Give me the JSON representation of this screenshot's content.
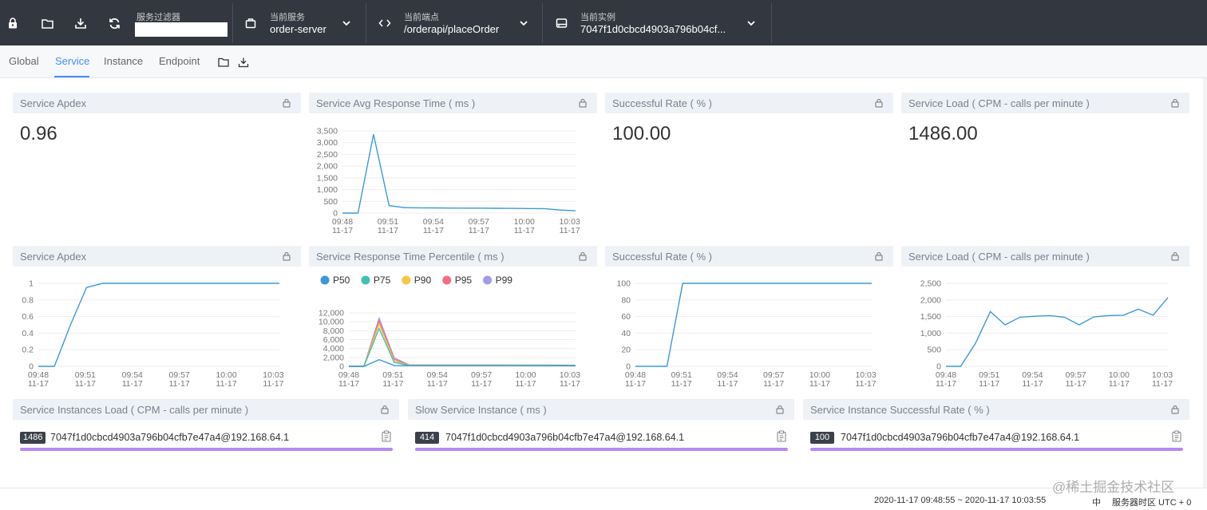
{
  "colors": {
    "topbar": "#333840",
    "accent": "#448dfe",
    "line": "#3a9ad9",
    "bar": "#b58af3"
  },
  "toolbar": {
    "icons": [
      "lock-icon",
      "folder-icon",
      "download-icon",
      "refresh-icon"
    ],
    "filter_label": "服务过滤器",
    "filter_value": "",
    "service_label": "当前服务",
    "service_value": "order-server",
    "endpoint_label": "当前端点",
    "endpoint_value": "/orderapi/placeOrder",
    "instance_label": "当前实例",
    "instance_value": "7047f1d0cbcd4903a796b04cf..."
  },
  "tabs": [
    "Global",
    "Service",
    "Instance",
    "Endpoint"
  ],
  "active_tab": "Service",
  "panels": {
    "apdex_value": {
      "title": "Service Apdex",
      "value": "0.96"
    },
    "avg_response": {
      "title": "Service Avg Response Time ( ms )"
    },
    "success_value": {
      "title": "Successful Rate ( % )",
      "value": "100.00"
    },
    "load_value": {
      "title": "Service Load ( CPM - calls per minute )",
      "value": "1486.00"
    },
    "apdex_chart": {
      "title": "Service Apdex"
    },
    "percentile": {
      "title": "Service Response Time Percentile ( ms )"
    },
    "success_chart": {
      "title": "Successful Rate ( % )"
    },
    "load_chart": {
      "title": "Service Load ( CPM - calls per minute )"
    },
    "instances_load": {
      "title": "Service Instances Load ( CPM - calls per minute )",
      "badge": "1486",
      "instance": "7047f1d0cbcd4903a796b04cfb7e47a4@192.168.64.1",
      "fill": 1.0
    },
    "slow_instance": {
      "title": "Slow Service Instance ( ms )",
      "badge": "414",
      "instance": "7047f1d0cbcd4903a796b04cfb7e47a4@192.168.64.1",
      "fill": 1.0
    },
    "instance_success": {
      "title": "Service Instance Successful Rate ( % )",
      "badge": "100",
      "instance": "7047f1d0cbcd4903a796b04cfb7e47a4@192.168.64.1",
      "fill": 1.0
    }
  },
  "chart_data": [
    {
      "id": "avg_response",
      "type": "line",
      "x_ticks": [
        "09:48\n11-17",
        "09:51\n11-17",
        "09:54\n11-17",
        "09:57\n11-17",
        "10:00\n11-17",
        "10:03\n11-17"
      ],
      "y_ticks": [
        "0",
        "500",
        "1,000",
        "1,500",
        "2,000",
        "2,500",
        "3,000",
        "3,500"
      ],
      "ylim": [
        0,
        3500
      ],
      "x": [
        0,
        1,
        2,
        3,
        4,
        5,
        6,
        7,
        8,
        9,
        10,
        11,
        12,
        13,
        14,
        15
      ],
      "series": [
        {
          "values": [
            0,
            0,
            3350,
            320,
            230,
            225,
            220,
            215,
            210,
            210,
            205,
            200,
            195,
            190,
            130,
            100
          ]
        }
      ]
    },
    {
      "id": "apdex_chart",
      "type": "line",
      "x_ticks": [
        "09:48\n11-17",
        "09:51\n11-17",
        "09:54\n11-17",
        "09:57\n11-17",
        "10:00\n11-17",
        "10:03\n11-17"
      ],
      "y_ticks": [
        "0",
        "0.2",
        "0.4",
        "0.6",
        "0.8",
        "1"
      ],
      "ylim": [
        0,
        1
      ],
      "x": [
        0,
        1,
        2,
        3,
        4,
        5,
        6,
        7,
        8,
        9,
        10,
        11,
        12,
        13,
        14,
        15
      ],
      "series": [
        {
          "values": [
            0,
            0,
            0.5,
            0.95,
            1,
            1,
            1,
            1,
            1,
            1,
            1,
            1,
            1,
            1,
            1,
            1
          ]
        }
      ]
    },
    {
      "id": "percentile",
      "type": "line",
      "x_ticks": [
        "09:48\n11-17",
        "09:51\n11-17",
        "09:54\n11-17",
        "09:57\n11-17",
        "10:00\n11-17",
        "10:03\n11-17"
      ],
      "y_ticks": [
        "0",
        "2,000",
        "4,000",
        "6,000",
        "8,000",
        "10,000",
        "12,000"
      ],
      "ylim": [
        0,
        12000
      ],
      "x": [
        0,
        1,
        2,
        3,
        4,
        5,
        6,
        7,
        8,
        9,
        10,
        11,
        12,
        13,
        14,
        15
      ],
      "series": [
        {
          "name": "P50",
          "color": "#3a9ad9",
          "values": [
            0,
            0,
            1500,
            200,
            150,
            150,
            150,
            140,
            140,
            140,
            140,
            140,
            130,
            130,
            120,
            110
          ]
        },
        {
          "name": "P75",
          "color": "#40c0b0",
          "values": [
            0,
            0,
            8500,
            900,
            200,
            200,
            200,
            200,
            200,
            200,
            200,
            200,
            200,
            200,
            180,
            170
          ]
        },
        {
          "name": "P90",
          "color": "#f4c842",
          "values": [
            0,
            0,
            9500,
            1200,
            250,
            240,
            240,
            240,
            230,
            230,
            230,
            230,
            230,
            220,
            200,
            190
          ]
        },
        {
          "name": "P95",
          "color": "#ef6f80",
          "values": [
            0,
            0,
            10200,
            1600,
            280,
            270,
            260,
            260,
            260,
            260,
            260,
            250,
            250,
            250,
            230,
            220
          ]
        },
        {
          "name": "P99",
          "color": "#a29be8",
          "values": [
            0,
            0,
            10800,
            1900,
            320,
            300,
            290,
            290,
            290,
            290,
            290,
            280,
            280,
            280,
            260,
            250
          ]
        }
      ]
    },
    {
      "id": "success_chart",
      "type": "line",
      "x_ticks": [
        "09:48\n11-17",
        "09:51\n11-17",
        "09:54\n11-17",
        "09:57\n11-17",
        "10:00\n11-17",
        "10:03\n11-17"
      ],
      "y_ticks": [
        "0",
        "20",
        "40",
        "60",
        "80",
        "100"
      ],
      "ylim": [
        0,
        100
      ],
      "x": [
        0,
        1,
        2,
        3,
        4,
        5,
        6,
        7,
        8,
        9,
        10,
        11,
        12,
        13,
        14,
        15
      ],
      "series": [
        {
          "values": [
            0,
            0,
            0,
            100,
            100,
            100,
            100,
            100,
            100,
            100,
            100,
            100,
            100,
            100,
            100,
            100
          ]
        }
      ]
    },
    {
      "id": "load_chart",
      "type": "line",
      "x_ticks": [
        "09:48\n11-17",
        "09:51\n11-17",
        "09:54\n11-17",
        "09:57\n11-17",
        "10:00\n11-17",
        "10:03\n11-17"
      ],
      "y_ticks": [
        "0",
        "500",
        "1,000",
        "1,500",
        "2,000",
        "2,500"
      ],
      "ylim": [
        0,
        2500
      ],
      "x": [
        0,
        1,
        2,
        3,
        4,
        5,
        6,
        7,
        8,
        9,
        10,
        11,
        12,
        13,
        14,
        15
      ],
      "series": [
        {
          "values": [
            0,
            0,
            700,
            1650,
            1250,
            1480,
            1510,
            1530,
            1480,
            1250,
            1490,
            1530,
            1540,
            1720,
            1540,
            2070
          ]
        }
      ]
    }
  ],
  "footer": {
    "range": "2020-11-17 09:48:55 ~ 2020-11-17 10:03:55",
    "lang": "中",
    "timezone": "服务器时区 UTC + 0"
  },
  "watermark": "@稀土掘金技术社区"
}
